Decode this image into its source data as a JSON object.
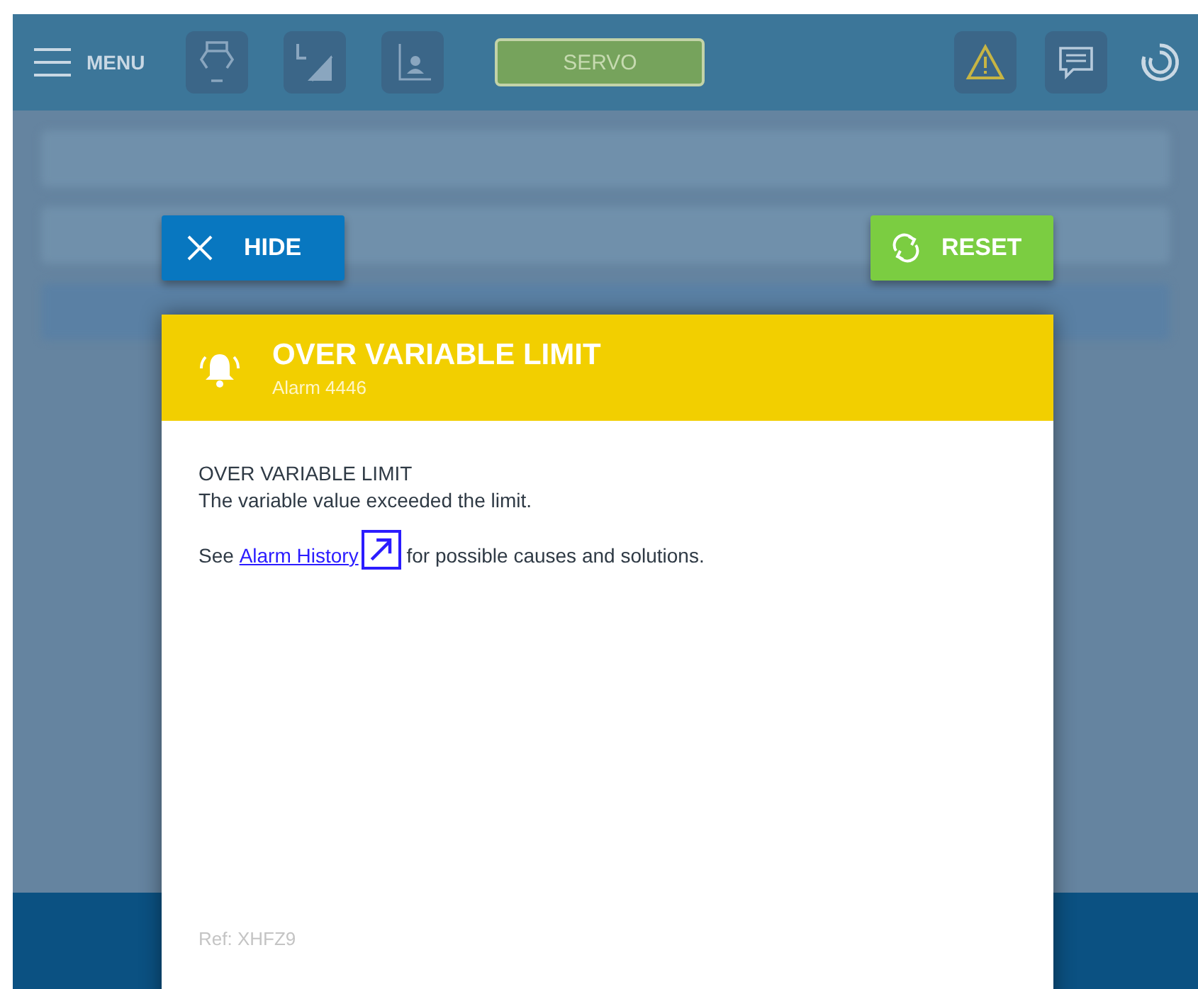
{
  "top_bar": {
    "menu_label": "MENU",
    "servo_label": "SERVO"
  },
  "dialog": {
    "hide_label": "HIDE",
    "reset_label": "RESET",
    "title": "OVER VARIABLE LIMIT",
    "subtitle": "Alarm 4446",
    "message_title": "OVER VARIABLE LIMIT",
    "message": "The variable value exceeded the limit.",
    "see_prefix": "See",
    "link": "Alarm History",
    "see_suffix": "for possible causes and solutions.",
    "ref": "Ref: XHFZ9"
  }
}
